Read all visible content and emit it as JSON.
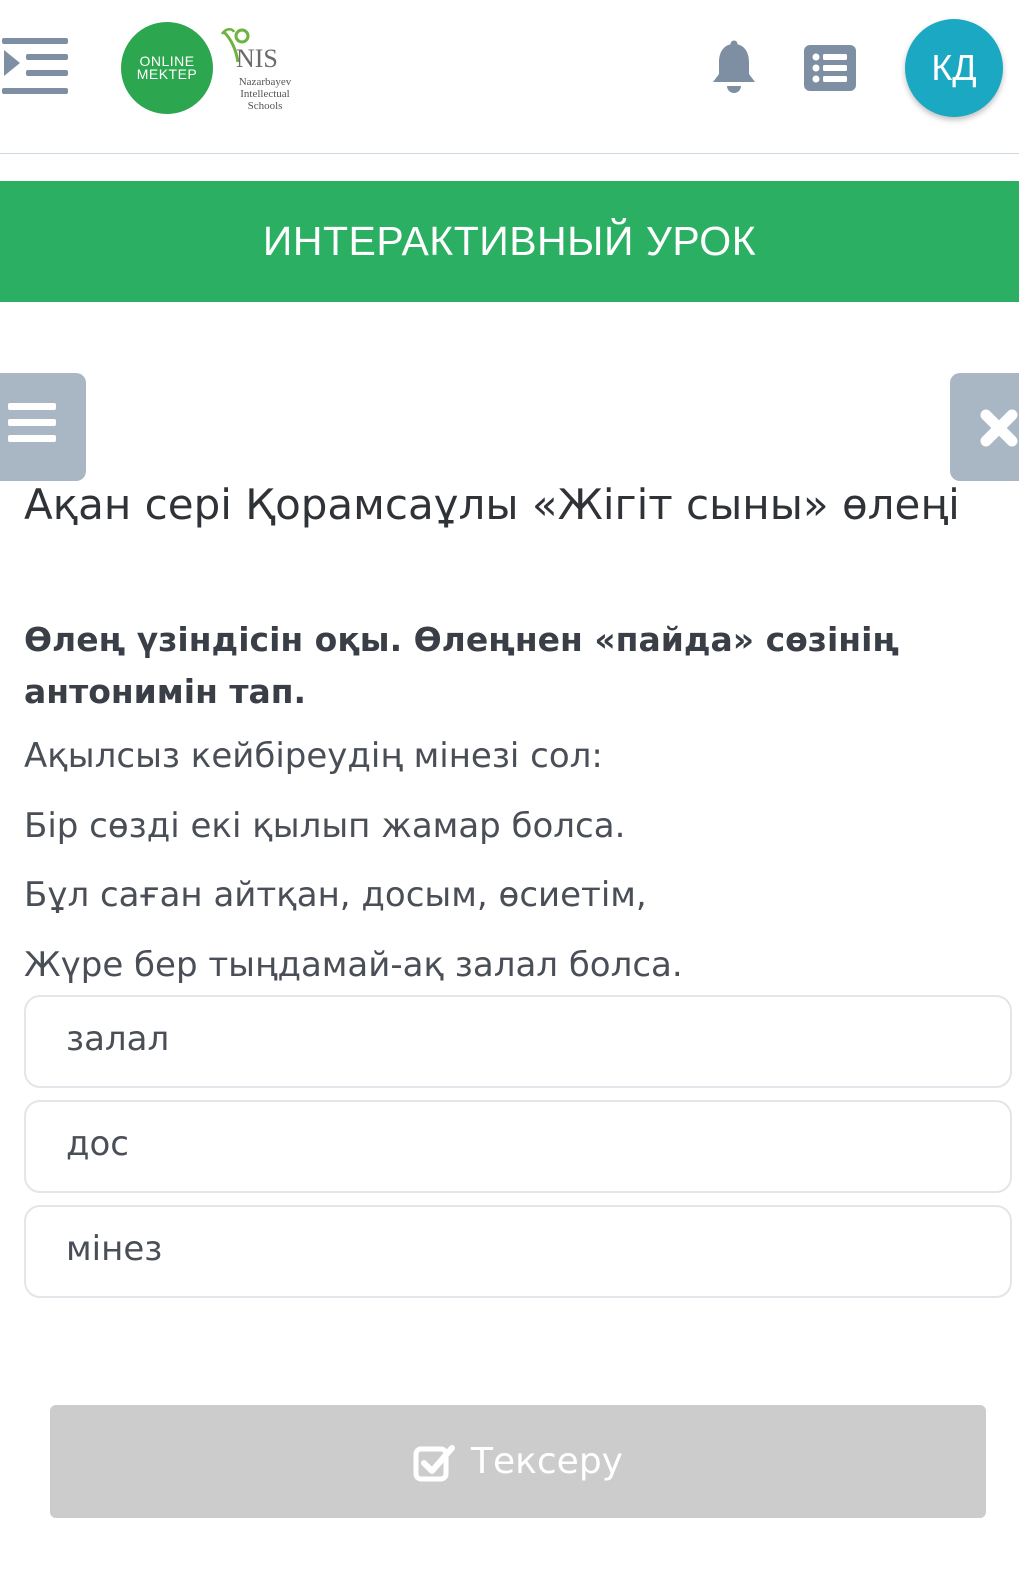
{
  "header": {
    "logo_online": "ONLINE",
    "logo_mektep": "MEKTEP",
    "logo_nis": "NIS",
    "logo_nis_sub1": "Nazarbayev",
    "logo_nis_sub2": "Intellectual",
    "logo_nis_sub3": "Schools",
    "avatar_initials": "КД"
  },
  "banner": {
    "title": "ИНТЕРАКТИВНЫЙ УРОК"
  },
  "lesson": {
    "title": "Ақан сері Қорамсаұлы «Жігіт сыны» өлеңі",
    "question": "Өлең үзіндісін оқы. Өлеңнен «пайда» сөзінің антонимін тап.",
    "poem": [
      "Ақылсыз кейбіреудің мінезі сол:",
      "Бір сөзді екі қылып жамар болса.",
      "Бұл саған айтқан, досым, өсиетім,",
      "Жүре бер тыңдамай-ақ залал болса."
    ],
    "options": [
      "залал",
      "дос",
      "мінез"
    ],
    "check_label": "Тексеру"
  },
  "colors": {
    "brand_green": "#2bb063",
    "avatar_teal": "#1ba8c2",
    "side_button_gray": "#a9b6c3",
    "disabled_button": "#cccccc"
  },
  "icons": [
    "sidebar-toggle-icon",
    "bell-icon",
    "list-icon",
    "hamburger-icon",
    "close-icon",
    "check-square-icon"
  ]
}
